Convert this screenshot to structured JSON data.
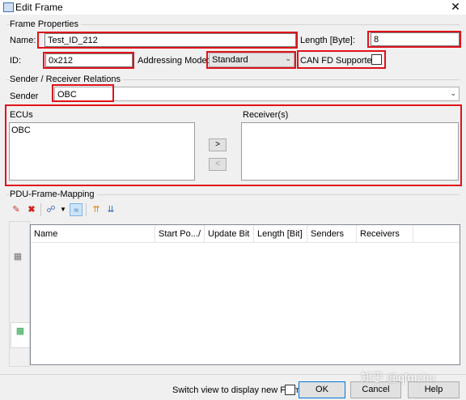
{
  "window": {
    "title": "Edit Frame",
    "close_symbol": "✕"
  },
  "frame_properties": {
    "group_title": "Frame Properties",
    "name_label": "Name:",
    "name_value": "Test_ID_212",
    "length_label": "Length [Byte]:",
    "length_value": "8",
    "id_label": "ID:",
    "id_value": "0x212",
    "addressing_label": "Addressing Mode:",
    "addressing_value": "Standard",
    "canfd_label": "CAN FD Supported:",
    "canfd_checked": false
  },
  "sender_receiver": {
    "group_title": "Sender / Receiver Relations",
    "sender_label": "Sender",
    "sender_value": "OBC",
    "ecus_label": "ECUs",
    "ecus_items": [
      "OBC"
    ],
    "receivers_label": "Receiver(s)",
    "receivers_items": [],
    "add_arrow": ">",
    "remove_arrow": "<"
  },
  "pdu_mapping": {
    "group_title": "PDU-Frame-Mapping",
    "toolbar": [
      "edit-icon",
      "delete-icon",
      "link-icon",
      "view-icon",
      "sort-up-icon",
      "sort-down-icon"
    ],
    "columns": [
      "Name",
      "Start Po...",
      "Update Bit",
      "Length [Bit]",
      "Senders",
      "Receivers"
    ],
    "sort_indicator": "/",
    "rows": []
  },
  "footer": {
    "switch_view_label": "Switch view to display new Frame",
    "switch_view_checked": false,
    "ok_label": "OK",
    "cancel_label": "Cancel",
    "help_label": "Help"
  },
  "watermark": "知乎 @qfmzhu",
  "colors": {
    "highlight_red": "#e0121a",
    "default_button_border": "#0078d7"
  }
}
